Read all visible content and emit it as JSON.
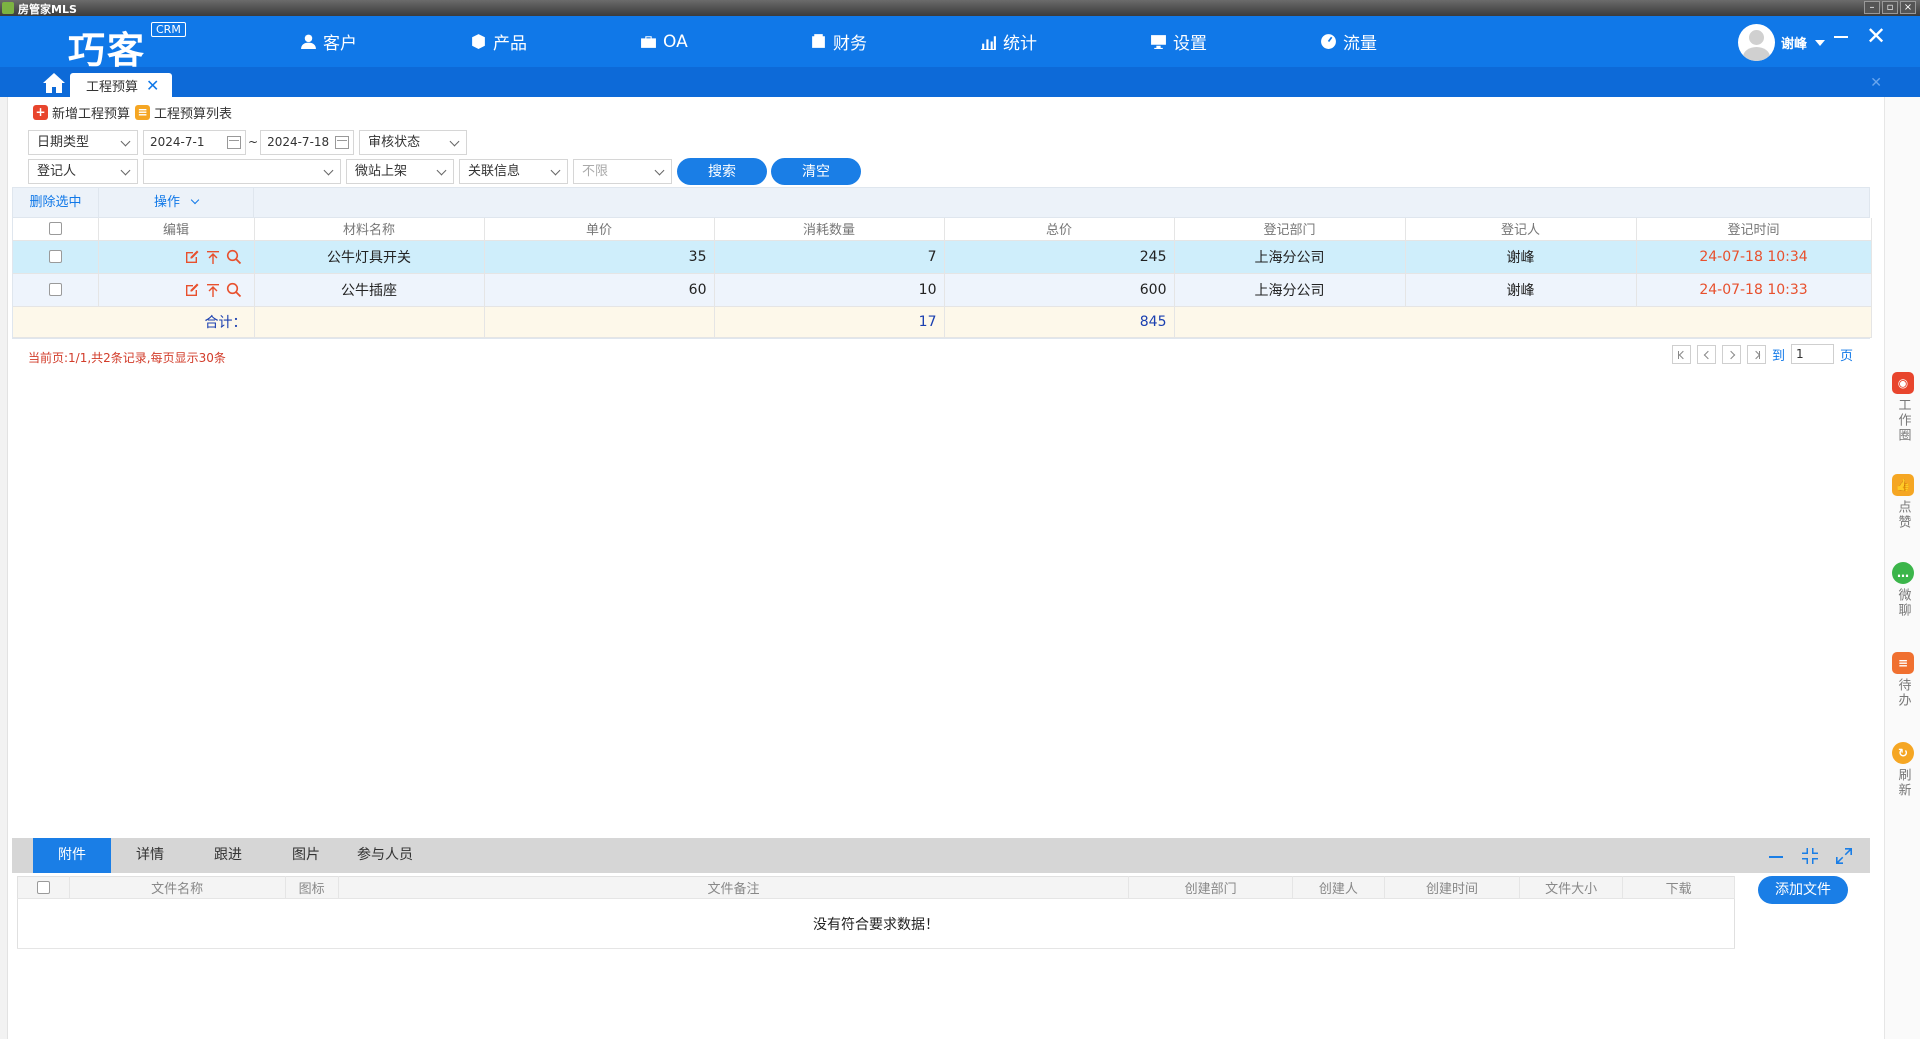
{
  "os": {
    "title": "房管家MLS"
  },
  "header": {
    "logo": "巧客",
    "badge": "CRM",
    "nav": [
      {
        "label": "客户",
        "icon": "user-icon"
      },
      {
        "label": "产品",
        "icon": "cube-icon"
      },
      {
        "label": "OA",
        "icon": "briefcase-icon"
      },
      {
        "label": "财务",
        "icon": "wallet-icon"
      },
      {
        "label": "统计",
        "icon": "chart-icon"
      },
      {
        "label": "设置",
        "icon": "monitor-icon"
      },
      {
        "label": "流量",
        "icon": "gauge-icon"
      }
    ],
    "user": {
      "name": "谢峰"
    }
  },
  "tabs": {
    "open_tab": "工程预算",
    "close_glyph": "✕"
  },
  "toolbar": {
    "add_label": "新增工程预算",
    "list_label": "工程预算列表"
  },
  "filters": {
    "date_type": "日期类型",
    "date_from": "2024-7-1",
    "date_sep": "~",
    "date_to": "2024-7-18",
    "audit_status": "审核状态",
    "registrant": "登记人",
    "blank_select": "",
    "micro_shelf": "微站上架",
    "link_info": "关联信息",
    "unlimited": "不限",
    "search_label": "搜索",
    "clear_label": "清空"
  },
  "grid": {
    "toolbar": {
      "delete_selected": "删除选中",
      "operations": "操作"
    },
    "columns": [
      "编辑",
      "材料名称",
      "单价",
      "消耗数量",
      "总价",
      "登记部门",
      "登记人",
      "登记时间"
    ],
    "rows": [
      {
        "name": "公牛灯具开关",
        "unit_price": "35",
        "qty": "7",
        "total": "245",
        "dept": "上海分公司",
        "user": "谢峰",
        "time": "24-07-18 10:34"
      },
      {
        "name": "公牛插座",
        "unit_price": "60",
        "qty": "10",
        "total": "600",
        "dept": "上海分公司",
        "user": "谢峰",
        "time": "24-07-18 10:33"
      }
    ],
    "summary": {
      "label": "合计：",
      "qty": "17",
      "total": "845"
    }
  },
  "pager": {
    "info": "当前页:1/1,共2条记录,每页显示30条",
    "goto_label": "到",
    "page_value": "1",
    "page_unit": "页"
  },
  "bottom": {
    "tabs": [
      "附件",
      "详情",
      "跟进",
      "图片",
      "参与人员"
    ],
    "columns": [
      "文件名称",
      "图标",
      "文件备注",
      "创建部门",
      "创建人",
      "创建时间",
      "文件大小",
      "下载"
    ],
    "empty_text": "没有符合要求数据！",
    "add_file_label": "添加文件"
  },
  "rail": [
    {
      "label": "工作圈",
      "icon": "record-icon",
      "color": "#e8452d"
    },
    {
      "label": "点赞",
      "icon": "thumbs-up-icon",
      "color": "#f5a623"
    },
    {
      "label": "微聊",
      "icon": "chat-icon",
      "color": "#3bb54a"
    },
    {
      "label": "待办",
      "icon": "todo-icon",
      "color": "#f07030"
    },
    {
      "label": "刷新",
      "icon": "refresh-icon",
      "color": "#f5a623"
    }
  ],
  "colors": {
    "brand": "#1078e8",
    "accent_orange": "#e8502d",
    "selected_row": "#cfeefb"
  }
}
